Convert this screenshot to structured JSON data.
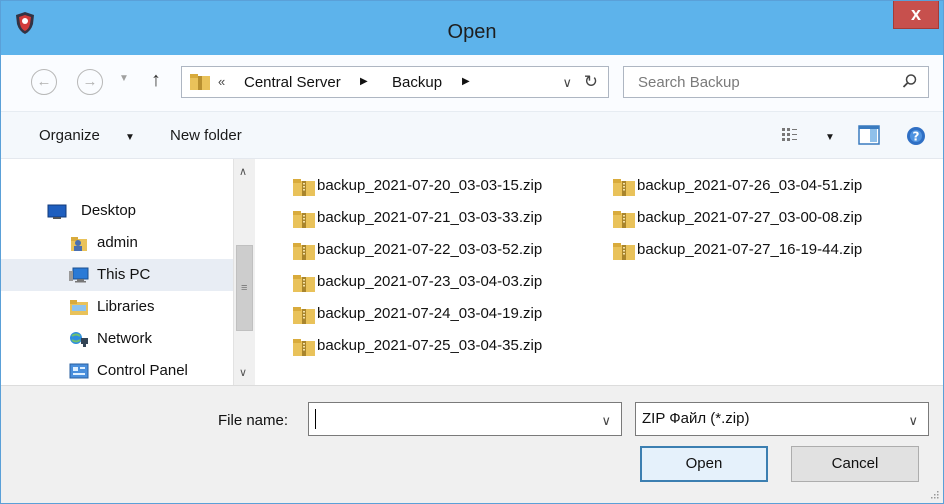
{
  "window": {
    "title": "Open",
    "close_label": "x"
  },
  "address": {
    "overflow": "«",
    "crumbs": [
      "Central Server",
      "Backup"
    ],
    "search_placeholder": "Search Backup"
  },
  "toolbar": {
    "organize_label": "Organize",
    "new_folder_label": "New folder"
  },
  "nav": {
    "items": [
      {
        "label": "Desktop",
        "icon": "desktop-icon"
      },
      {
        "label": "admin",
        "icon": "user-folder-icon"
      },
      {
        "label": "This PC",
        "icon": "computer-icon",
        "selected": true
      },
      {
        "label": "Libraries",
        "icon": "libraries-icon"
      },
      {
        "label": "Network",
        "icon": "network-icon"
      },
      {
        "label": "Control Panel",
        "icon": "control-panel-icon"
      }
    ]
  },
  "files": [
    "backup_2021-07-20_03-03-15.zip",
    "backup_2021-07-21_03-03-33.zip",
    "backup_2021-07-22_03-03-52.zip",
    "backup_2021-07-23_03-04-03.zip",
    "backup_2021-07-24_03-04-19.zip",
    "backup_2021-07-25_03-04-35.zip",
    "backup_2021-07-26_03-04-51.zip",
    "backup_2021-07-27_03-00-08.zip",
    "backup_2021-07-27_16-19-44.zip"
  ],
  "bottom": {
    "file_name_label": "File name:",
    "file_name_value": "",
    "file_type": "ZIP Файл (*.zip)",
    "open_label": "Open",
    "cancel_label": "Cancel"
  },
  "colors": {
    "titlebar": "#5db3eb",
    "close": "#c7504d",
    "zip_folder": "#e9c25a"
  }
}
